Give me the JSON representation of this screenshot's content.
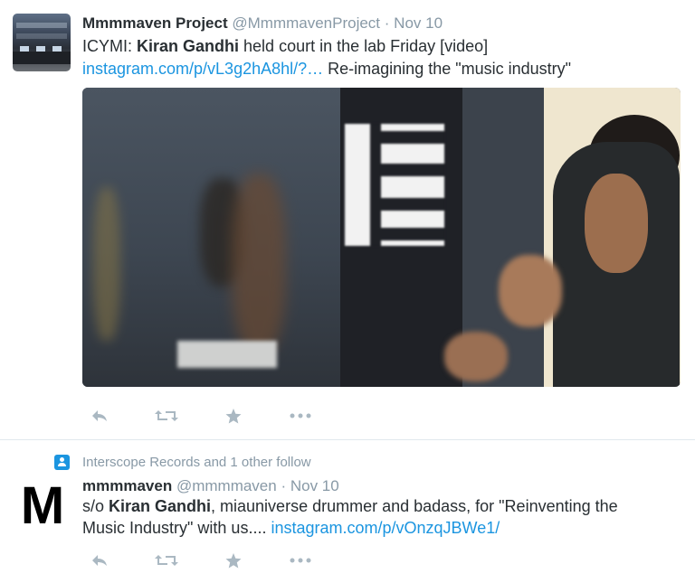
{
  "tweets": [
    {
      "avatar": "lab-photo",
      "name": "Mmmmaven Project",
      "handle": "@MmmmavenProject",
      "time": "· Nov 10",
      "text_lines": [
        {
          "pre": "ICYMI: ",
          "bold": "Kiran Gandhi",
          "post": " held court in the lab Friday [video]"
        },
        {
          "link": "instagram.com/p/vL3g2hA8hl/?…",
          "post": " Re-imagining the \"music industry\""
        }
      ],
      "media": "video-thumbnail",
      "actions": [
        "reply-icon",
        "retweet-icon",
        "favorite-icon",
        "more-icon"
      ]
    },
    {
      "social_context": "Interscope Records and 1 other follow",
      "avatar_letter": "M",
      "name": "mmmmaven",
      "handle": "@mmmmaven",
      "time": "· Nov 10",
      "text_lines": [
        {
          "pre": "s/o ",
          "bold": "Kiran Gandhi",
          "post": ", miauniverse  drummer and badass, for \"Reinventing the"
        },
        {
          "pre": "Music Industry\" with us.... ",
          "link": "instagram.com/p/vOnzqJBWe1/"
        }
      ],
      "actions": [
        "reply-icon",
        "retweet-icon",
        "favorite-icon",
        "more-icon"
      ]
    }
  ],
  "colors": {
    "link": "#1b95e0",
    "muted": "#8899a6",
    "action": "#aab8c2",
    "text": "#292f33"
  }
}
